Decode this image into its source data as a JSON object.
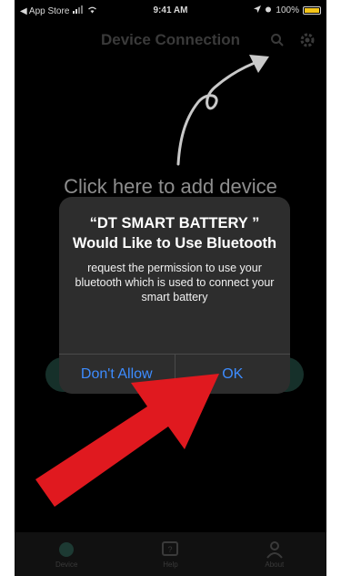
{
  "status_bar": {
    "back_label": "◀ App Store",
    "time": "9:41 AM",
    "battery": "100%"
  },
  "nav": {
    "title": "Device Connection"
  },
  "main": {
    "hint_text": "Click here to add device"
  },
  "dialog": {
    "title": "“DT SMART BATTERY ” Would Like to Use Bluetooth",
    "message": "request the permission to use your bluetooth which is used to connect your smart battery",
    "dont_allow_label": "Don't Allow",
    "ok_label": "OK"
  },
  "colors": {
    "accent": "#3d8cff",
    "arrow": "#e0191f",
    "battery": "#f5c518"
  },
  "tabs": [
    {
      "label": "Device",
      "icon": "device-icon"
    },
    {
      "label": "Help",
      "icon": "help-icon"
    },
    {
      "label": "About",
      "icon": "profile-icon"
    }
  ]
}
